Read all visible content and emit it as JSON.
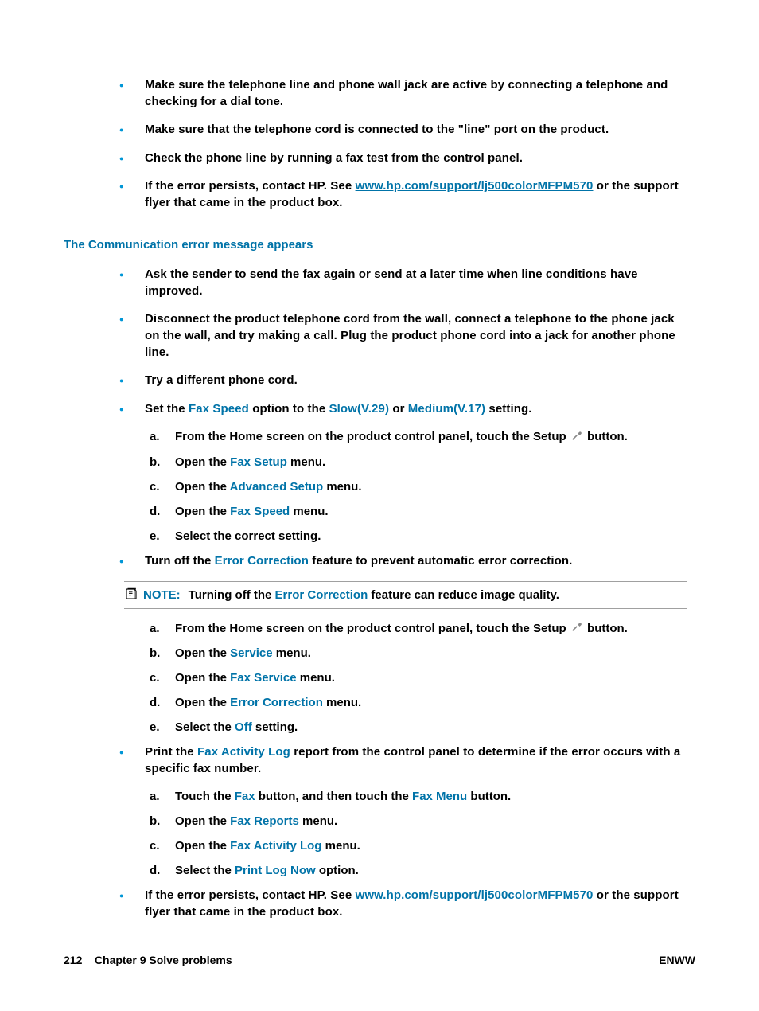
{
  "section1": {
    "b1": "Make sure the telephone line and phone wall jack are active by connecting a telephone and checking for a dial tone.",
    "b2": "Make sure that the telephone cord is connected to the \"line\" port on the product.",
    "b3": "Check the phone line by running a fax test from the control panel.",
    "b4a": "If the error persists, contact HP. See ",
    "b4link": "www.hp.com/support/lj500colorMFPM570",
    "b4b": " or the support flyer that came in the product box."
  },
  "heading": "The Communication error message appears",
  "section2": {
    "b1": "Ask the sender to send the fax again or send at a later time when line conditions have improved.",
    "b2": "Disconnect the product telephone cord from the wall, connect a telephone to the phone jack on the wall, and try making a call. Plug the product phone cord into a jack for another phone line.",
    "b3": "Try a different phone cord.",
    "b4_pre": "Set the ",
    "b4_ui1": "Fax Speed",
    "b4_mid1": " option to the ",
    "b4_ui2": "Slow(V.29)",
    "b4_mid2": " or ",
    "b4_ui3": "Medium(V.17)",
    "b4_post": " setting.",
    "b4_steps": {
      "a_pre": "From the Home screen on the product control panel, touch the Setup ",
      "a_post": " button.",
      "b_pre": "Open the ",
      "b_ui": "Fax Setup",
      "b_post": " menu.",
      "c_pre": "Open the ",
      "c_ui": "Advanced Setup",
      "c_post": " menu.",
      "d_pre": "Open the ",
      "d_ui": "Fax Speed",
      "d_post": " menu.",
      "e": "Select the correct setting."
    },
    "b5_pre": "Turn off the ",
    "b5_ui": "Error Correction",
    "b5_post": " feature to prevent automatic error correction.",
    "note_label": "NOTE:",
    "note_pre": "Turning off the ",
    "note_ui": "Error Correction",
    "note_post": " feature can reduce image quality.",
    "b5_steps": {
      "a_pre": "From the Home screen on the product control panel, touch the Setup ",
      "a_post": " button.",
      "b_pre": "Open the ",
      "b_ui": "Service",
      "b_post": " menu.",
      "c_pre": "Open the ",
      "c_ui": "Fax Service",
      "c_post": " menu.",
      "d_pre": "Open the ",
      "d_ui": "Error Correction",
      "d_post": " menu.",
      "e_pre": "Select the ",
      "e_ui": "Off",
      "e_post": " setting."
    },
    "b6_pre": "Print the ",
    "b6_ui": "Fax Activity Log",
    "b6_post": " report from the control panel to determine if the error occurs with a specific fax number.",
    "b6_steps": {
      "a_pre": "Touch the ",
      "a_ui1": "Fax",
      "a_mid": " button, and then touch the ",
      "a_ui2": "Fax Menu",
      "a_post": " button.",
      "b_pre": "Open the ",
      "b_ui": "Fax Reports",
      "b_post": " menu.",
      "c_pre": "Open the ",
      "c_ui": "Fax Activity Log",
      "c_post": " menu.",
      "d_pre": "Select the ",
      "d_ui": "Print Log Now",
      "d_post": " option."
    },
    "b7a": "If the error persists, contact HP. See ",
    "b7link": "www.hp.com/support/lj500colorMFPM570",
    "b7b": " or the support flyer that came in the product box."
  },
  "markers": {
    "a": "a.",
    "b": "b.",
    "c": "c.",
    "d": "d.",
    "e": "e."
  },
  "footer": {
    "left_page": "212",
    "left_chapter": "Chapter 9   Solve problems",
    "right": "ENWW"
  }
}
